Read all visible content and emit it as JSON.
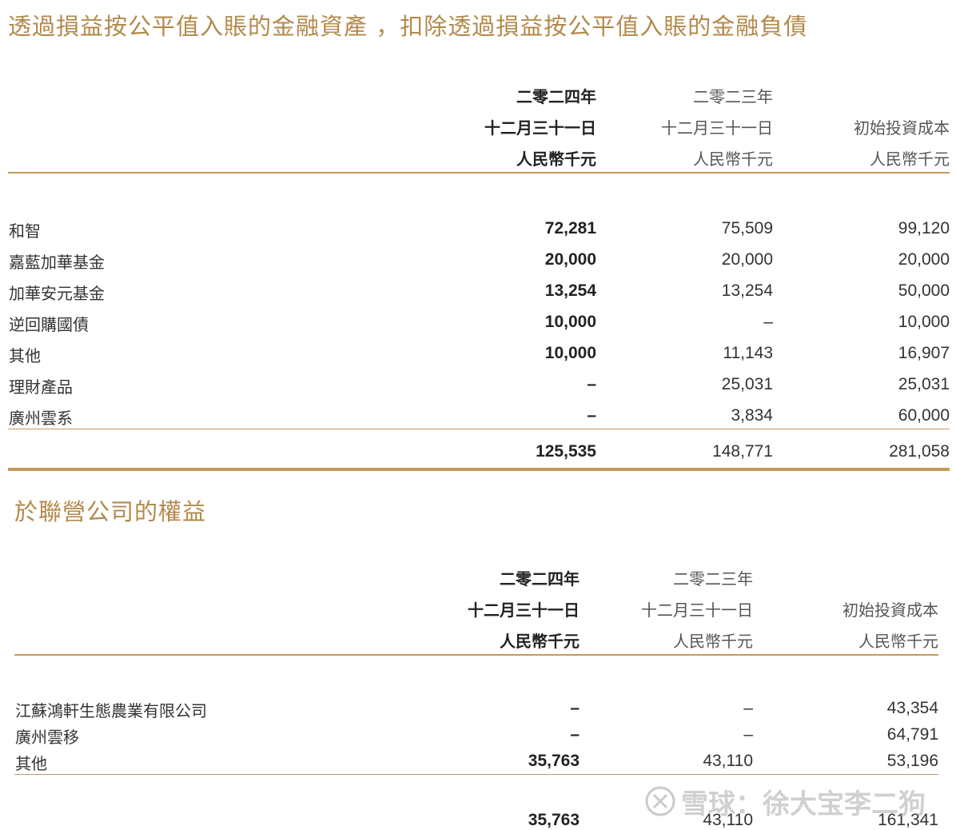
{
  "section1": {
    "title": "透過損益按公平值入賬的金融資產 ，扣除透過損益按公平值入賬的金融負債",
    "headers": {
      "col1": [
        "二零二四年",
        "十二月三十一日",
        "人民幣千元"
      ],
      "col2": [
        "二零二三年",
        "十二月三十一日",
        "人民幣千元"
      ],
      "col3": [
        "初始投資成本",
        "人民幣千元"
      ]
    },
    "rows": [
      {
        "label": "和智",
        "v2024": "72,281",
        "v2023": "75,509",
        "cost": "99,120"
      },
      {
        "label": "嘉藍加華基金",
        "v2024": "20,000",
        "v2023": "20,000",
        "cost": "20,000"
      },
      {
        "label": "加華安元基金",
        "v2024": "13,254",
        "v2023": "13,254",
        "cost": "50,000"
      },
      {
        "label": "逆回購國債",
        "v2024": "10,000",
        "v2023": "–",
        "cost": "10,000"
      },
      {
        "label": "其他",
        "v2024": "10,000",
        "v2023": "11,143",
        "cost": "16,907"
      },
      {
        "label": "理財產品",
        "v2024": "–",
        "v2023": "25,031",
        "cost": "25,031"
      },
      {
        "label": "廣州雲系",
        "v2024": "–",
        "v2023": "3,834",
        "cost": "60,000"
      }
    ],
    "total": {
      "v2024": "125,535",
      "v2023": "148,771",
      "cost": "281,058"
    }
  },
  "section2": {
    "title": "於聯營公司的權益",
    "headers": {
      "col1": [
        "二零二四年",
        "十二月三十一日",
        "人民幣千元"
      ],
      "col2": [
        "二零二三年",
        "十二月三十一日",
        "人民幣千元"
      ],
      "col3": [
        "初始投資成本",
        "人民幣千元"
      ]
    },
    "rows": [
      {
        "label": "江蘇鴻軒生態農業有限公司",
        "v2024": "–",
        "v2023": "–",
        "cost": "43,354"
      },
      {
        "label": "廣州雲移",
        "v2024": "–",
        "v2023": "–",
        "cost": "64,791"
      },
      {
        "label": "其他",
        "v2024": "35,763",
        "v2023": "43,110",
        "cost": "53,196"
      }
    ],
    "total": {
      "v2024": "35,763",
      "v2023": "43,110",
      "cost": "161,341"
    }
  },
  "watermark": {
    "text": "雪球：徐大宝李二狗",
    "icon": "snowball-logo-icon"
  },
  "colors": {
    "accent": "#b3894a",
    "rule": "#c49a5d"
  }
}
